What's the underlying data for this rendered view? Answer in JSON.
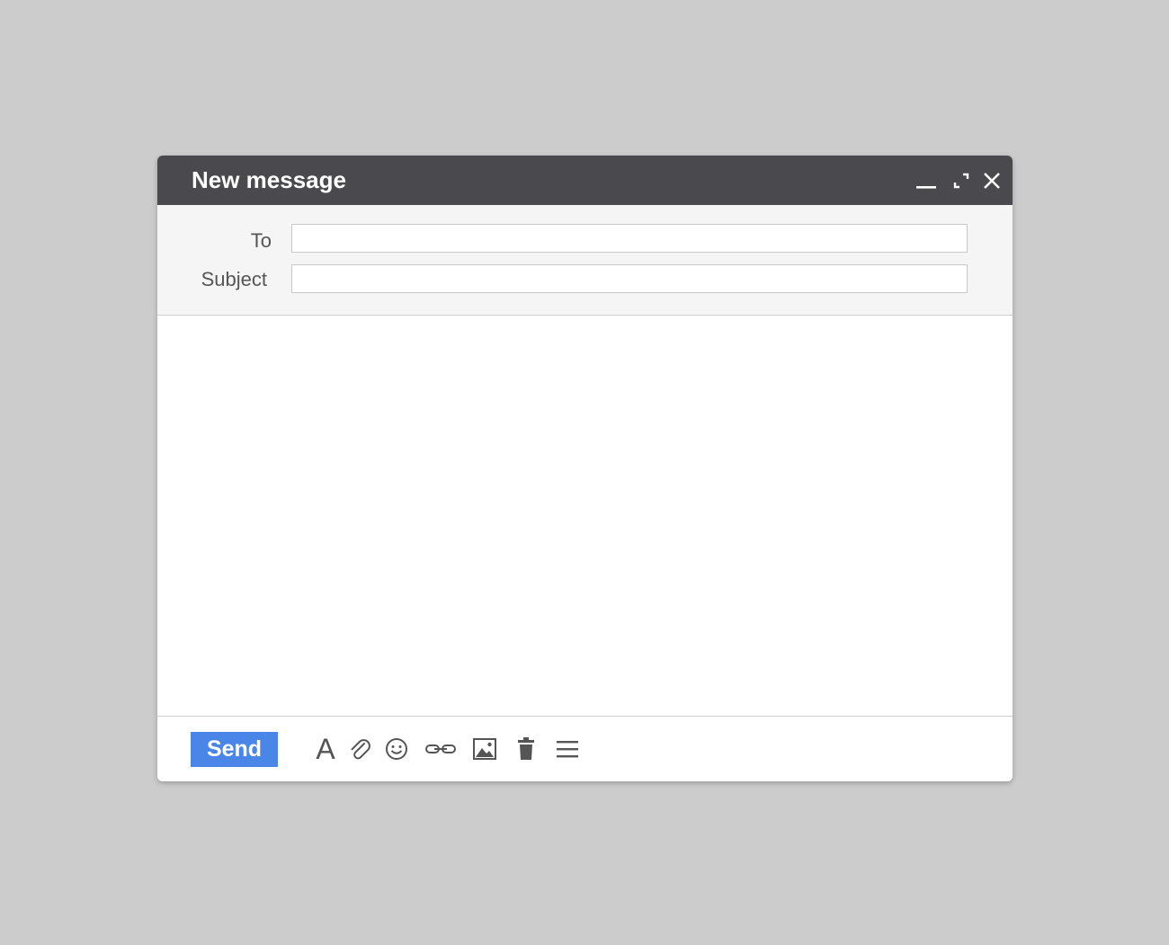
{
  "window": {
    "title": "New message"
  },
  "titlebar_controls": {
    "minimize_icon": "minimize-icon",
    "expand_icon": "expand-icon",
    "close_icon": "close-icon"
  },
  "fields": {
    "to_label": "To",
    "to_value": "",
    "subject_label": "Subject",
    "subject_value": ""
  },
  "body": {
    "value": ""
  },
  "toolbar": {
    "send_label": "Send",
    "font_label": "A",
    "tools": [
      "formatting-icon",
      "attach-icon",
      "emoji-icon",
      "link-icon",
      "image-icon",
      "trash-icon",
      "more-options-icon"
    ]
  },
  "colors": {
    "background": "#cccccc",
    "titlebar": "#4a4a4e",
    "send_button": "#4a86e8",
    "header_fields": "#f5f5f5",
    "icon": "#555555"
  }
}
